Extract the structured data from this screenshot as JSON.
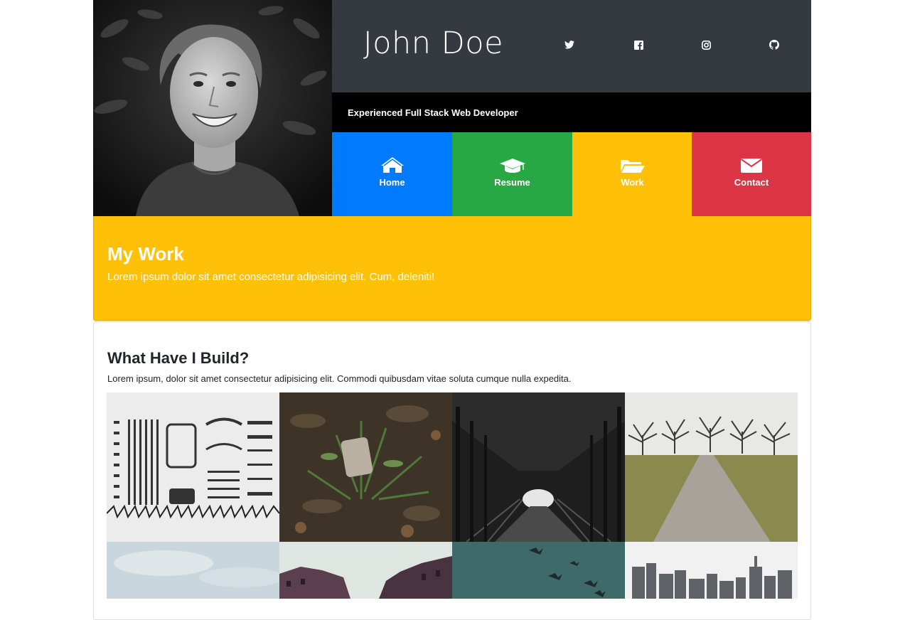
{
  "profile": {
    "name": "John Doe",
    "tagline": "Experienced Full Stack Web Developer"
  },
  "social": [
    {
      "icon": "twitter-icon"
    },
    {
      "icon": "facebook-icon"
    },
    {
      "icon": "instagram-icon"
    },
    {
      "icon": "github-icon"
    }
  ],
  "nav": [
    {
      "label": "Home",
      "icon": "home-icon",
      "color": "#007bff"
    },
    {
      "label": "Resume",
      "icon": "graduation-cap-icon",
      "color": "#28a745"
    },
    {
      "label": "Work",
      "icon": "folder-open-icon",
      "color": "#ffc107"
    },
    {
      "label": "Contact",
      "icon": "envelope-icon",
      "color": "#dc3545"
    }
  ],
  "banner": {
    "title": "My Work",
    "subtitle": "Lorem ipsum dolor sit amet consectetur adipisicing elit. Cum, deleniti!"
  },
  "work": {
    "title": "What Have I Build?",
    "description": "Lorem ipsum, dolor sit amet consectetur adipisicing elit. Commodi quibusdam vitae soluta cumque nulla expedita."
  },
  "colors": {
    "header_dark": "#343a40",
    "tagline_bg": "#000000",
    "banner": "#ffc107"
  }
}
